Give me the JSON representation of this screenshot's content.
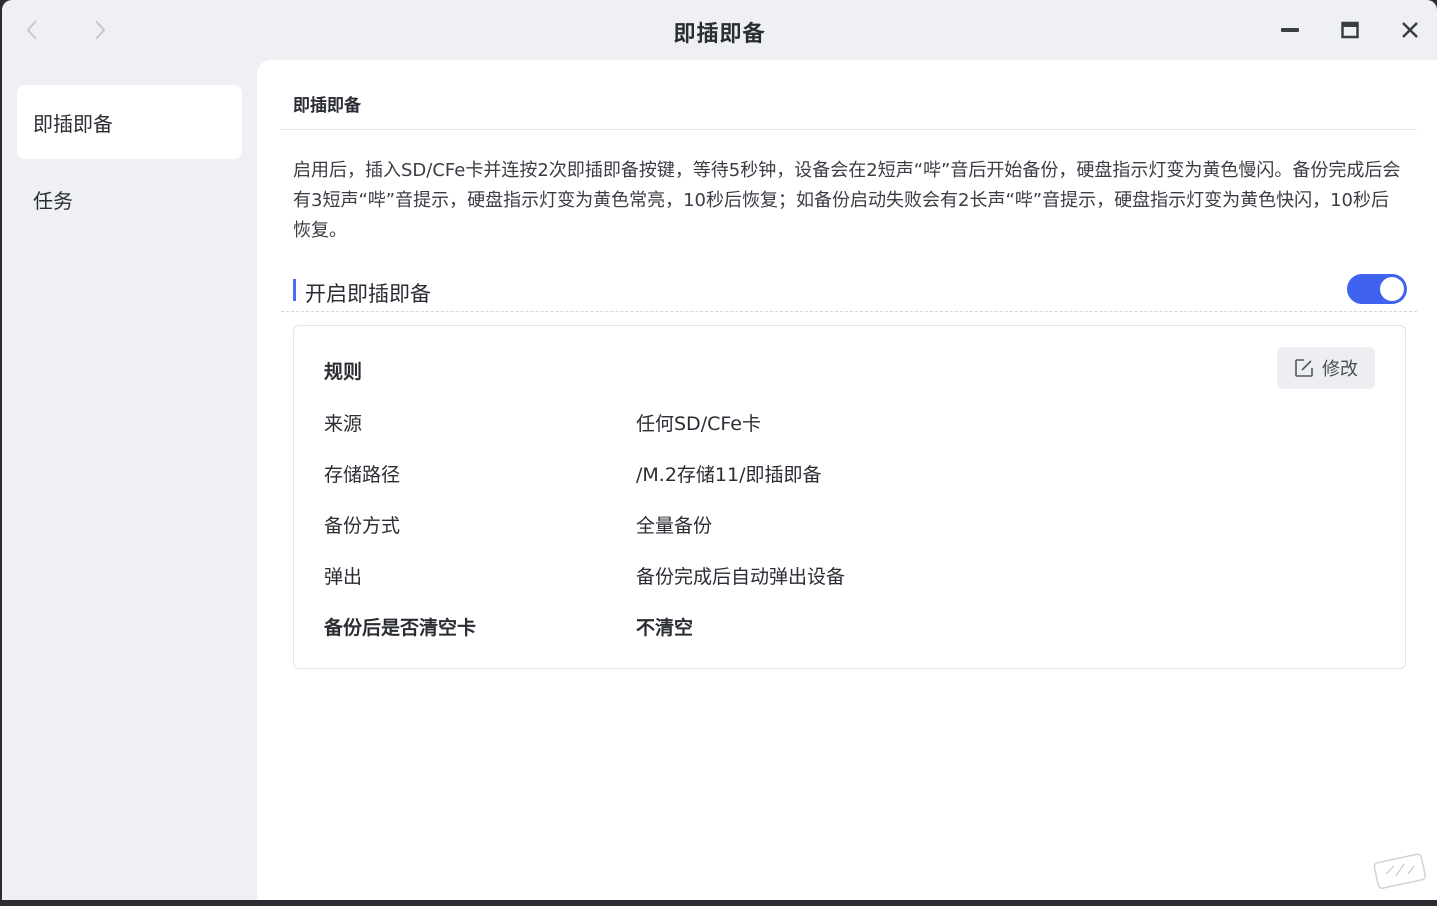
{
  "window": {
    "title": "即插即备"
  },
  "sidebar": {
    "items": [
      {
        "label": "即插即备",
        "active": true
      },
      {
        "label": "任务",
        "active": false
      }
    ]
  },
  "main": {
    "section_title": "即插即备",
    "description": "启用后，插入SD/CFe卡并连按2次即插即备按键，等待5秒钟，设备会在2短声“哔”音后开始备份，硬盘指示灯变为黄色慢闪。备份完成后会有3短声“哔”音提示，硬盘指示灯变为黄色常亮，10秒后恢复；如备份启动失败会有2长声“哔”音提示，硬盘指示灯变为黄色快闪，10秒后恢复。",
    "toggle": {
      "label": "开启即插即备",
      "enabled": true
    },
    "rules": {
      "title": "规则",
      "edit_label": "修改",
      "rows": [
        {
          "key": "来源",
          "value": "任何SD/CFe卡"
        },
        {
          "key": "存储路径",
          "value": "/M.2存储11/即插即备"
        },
        {
          "key": "备份方式",
          "value": "全量备份"
        },
        {
          "key": "弹出",
          "value": "备份完成后自动弹出设备"
        },
        {
          "key": "备份后是否清空卡",
          "value": "不清空"
        }
      ]
    }
  },
  "colors": {
    "accent": "#3f62f0",
    "sidebar_bg": "#eef0f3",
    "content_bg": "#ffffff"
  },
  "icons": {
    "back": "chevron-left-icon",
    "forward": "chevron-right-icon",
    "minimize": "minimize-icon",
    "maximize": "maximize-icon",
    "close": "close-icon",
    "edit": "edit-icon"
  }
}
